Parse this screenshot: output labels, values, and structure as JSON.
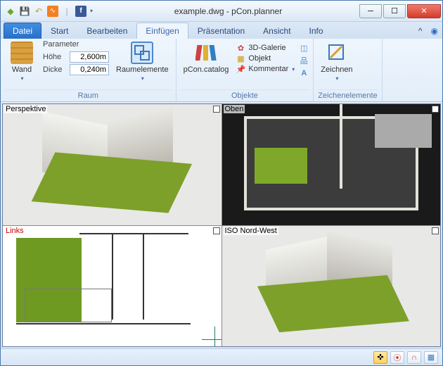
{
  "title": "example.dwg - pCon.planner",
  "qat_icons": [
    "app",
    "save",
    "undo",
    "rss",
    "divider",
    "facebook"
  ],
  "tabs": {
    "file": "Datei",
    "items": [
      "Start",
      "Bearbeiten",
      "Einfügen",
      "Präsentation",
      "Ansicht",
      "Info"
    ],
    "active_index": 2
  },
  "ribbon": {
    "raum": {
      "label": "Raum",
      "wand": "Wand",
      "parameter": "Parameter",
      "hoehe_label": "Höhe",
      "hoehe_value": "2,600m",
      "dicke_label": "Dicke",
      "dicke_value": "0,240m",
      "raumelemente": "Raumelemente"
    },
    "objekte": {
      "label": "Objekte",
      "catalog": "pCon.catalog",
      "galerie": "3D-Galerie",
      "objekt": "Objekt",
      "kommentar": "Kommentar"
    },
    "zeichen": {
      "label": "Zeichenelemente",
      "zeichnen": "Zeichnen"
    }
  },
  "viewports": {
    "tl": "Perspektive",
    "tr": "Oben",
    "bl": "Links",
    "br": "ISO Nord-West",
    "active": "bl"
  },
  "statusbar": {
    "buttons": [
      "axes",
      "snap",
      "magnet",
      "grid"
    ]
  }
}
